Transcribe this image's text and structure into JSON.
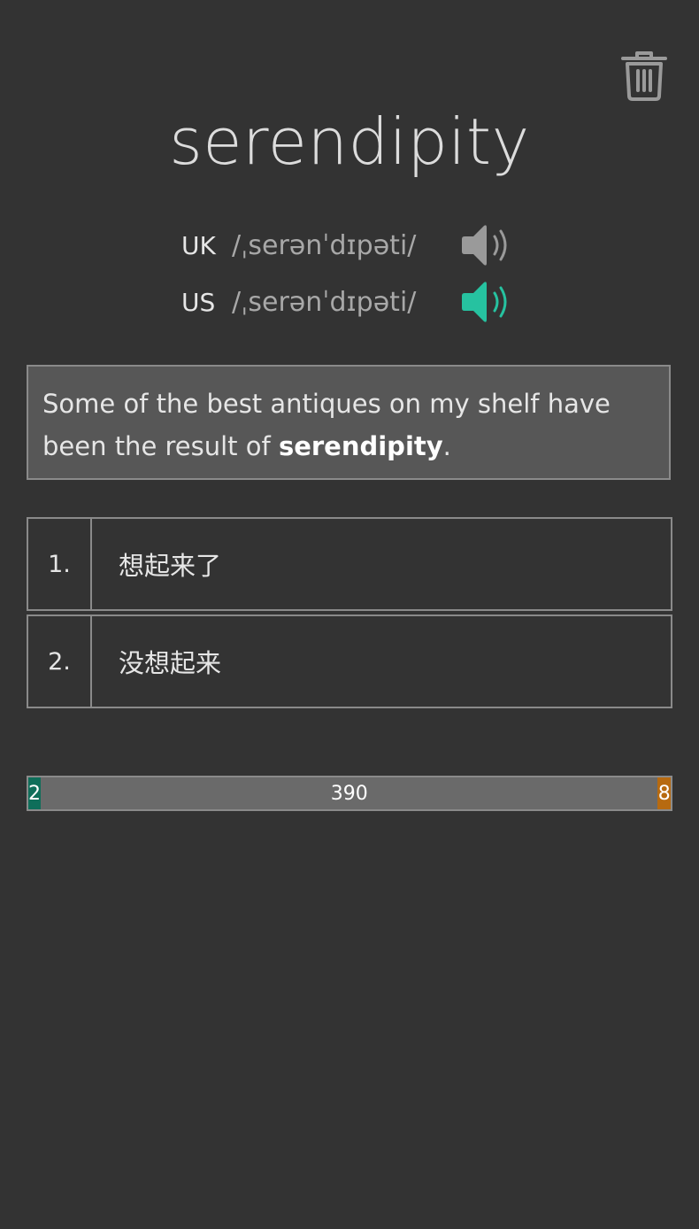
{
  "card": {
    "word": "serendipity",
    "pronunciations": [
      {
        "region": "UK",
        "ipa": "/ˌserənˈdɪpəti/",
        "icon": "speaker-icon",
        "color": "#9a9a9a"
      },
      {
        "region": "US",
        "ipa": "/ˌserənˈdɪpəti/",
        "icon": "speaker-icon",
        "color": "#26c2a0"
      }
    ],
    "example": {
      "before": "Some of the best antiques on my shelf have been the result of ",
      "highlight": "serendipity",
      "after": "."
    }
  },
  "choices": [
    {
      "number": "1.",
      "label": "想起来了"
    },
    {
      "number": "2.",
      "label": "没想起来"
    }
  ],
  "progress": {
    "known": 2,
    "remaining": 390,
    "wrong": 8,
    "colors": {
      "known": "#0f6e5a",
      "remaining": "#6a6a6a",
      "wrong": "#b76a10"
    }
  },
  "toolbar": {
    "delete_icon": "trash-icon"
  }
}
